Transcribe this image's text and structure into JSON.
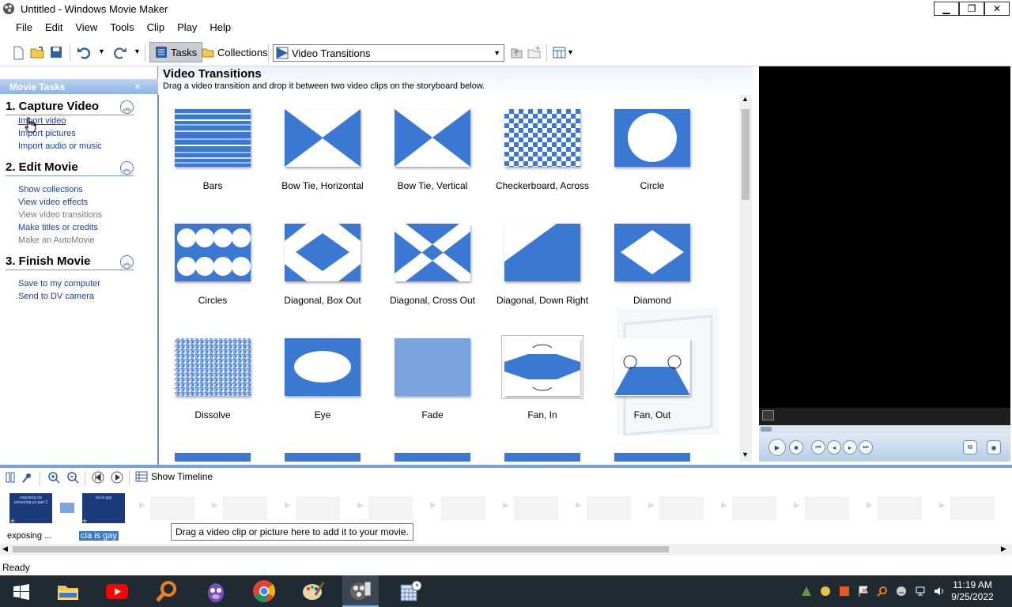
{
  "window": {
    "title": "Untitled - Windows Movie Maker",
    "icon": "movie-maker-icon",
    "controls": [
      "minimize-icon",
      "restore-icon",
      "close-icon"
    ]
  },
  "menu": [
    "File",
    "Edit",
    "View",
    "Tools",
    "Clip",
    "Play",
    "Help"
  ],
  "toolbar": {
    "tasks_label": "Tasks",
    "collections_label": "Collections",
    "collection_select": "Video Transitions"
  },
  "taskpane": {
    "header": "Movie Tasks",
    "close": "×",
    "sections": [
      {
        "title": "1. Capture Video",
        "items": [
          {
            "label": "Import video",
            "enabled": true
          },
          {
            "label": "Import pictures",
            "enabled": true
          },
          {
            "label": "Import audio or music",
            "enabled": true
          }
        ]
      },
      {
        "title": "2. Edit Movie",
        "items": [
          {
            "label": "Show collections",
            "enabled": true
          },
          {
            "label": "View video effects",
            "enabled": true
          },
          {
            "label": "View video transitions",
            "enabled": false
          },
          {
            "label": "Make titles or credits",
            "enabled": true
          },
          {
            "label": "Make an AutoMovie",
            "enabled": false
          }
        ]
      },
      {
        "title": "3. Finish Movie",
        "items": [
          {
            "label": "Save to my computer",
            "enabled": true
          },
          {
            "label": "Send to DV camera",
            "enabled": true
          }
        ]
      }
    ]
  },
  "content": {
    "title": "Video Transitions",
    "subtitle": "Drag a video transition and drop it between two video clips on the storyboard below.",
    "transitions": [
      "Bars",
      "Bow Tie, Horizontal",
      "Bow Tie, Vertical",
      "Checkerboard, Across",
      "Circle",
      "Circles",
      "Diagonal, Box Out",
      "Diagonal, Cross Out",
      "Diagonal, Down Right",
      "Diamond",
      "Dissolve",
      "Eye",
      "Fade",
      "Fan, In",
      "Fan, Out"
    ],
    "selected": "Fan, In"
  },
  "storyboard": {
    "show_timeline_label": "Show Timeline",
    "clips": [
      {
        "label": "exposing ...",
        "thumb_text": "exposing cia censoring us part 2"
      },
      {
        "label": "cia is gay",
        "thumb_text": "cia is gay"
      }
    ],
    "tooltip": "Drag a video clip or picture here to add it to your movie."
  },
  "status": "Ready",
  "taskbar": {
    "time": "11:19 AM",
    "date": "9/25/2022",
    "apps": [
      "windows-start-icon",
      "file-explorer-icon",
      "youtube-icon",
      "search-magnifier-icon",
      "bonzi-buddy-icon",
      "chrome-icon",
      "paint-icon",
      "movie-maker-icon",
      "task-scheduler-icon"
    ]
  },
  "colors": {
    "accent": "#3a78d4",
    "task_link": "#1c3f9a",
    "taskbar": "#1f2a33"
  }
}
